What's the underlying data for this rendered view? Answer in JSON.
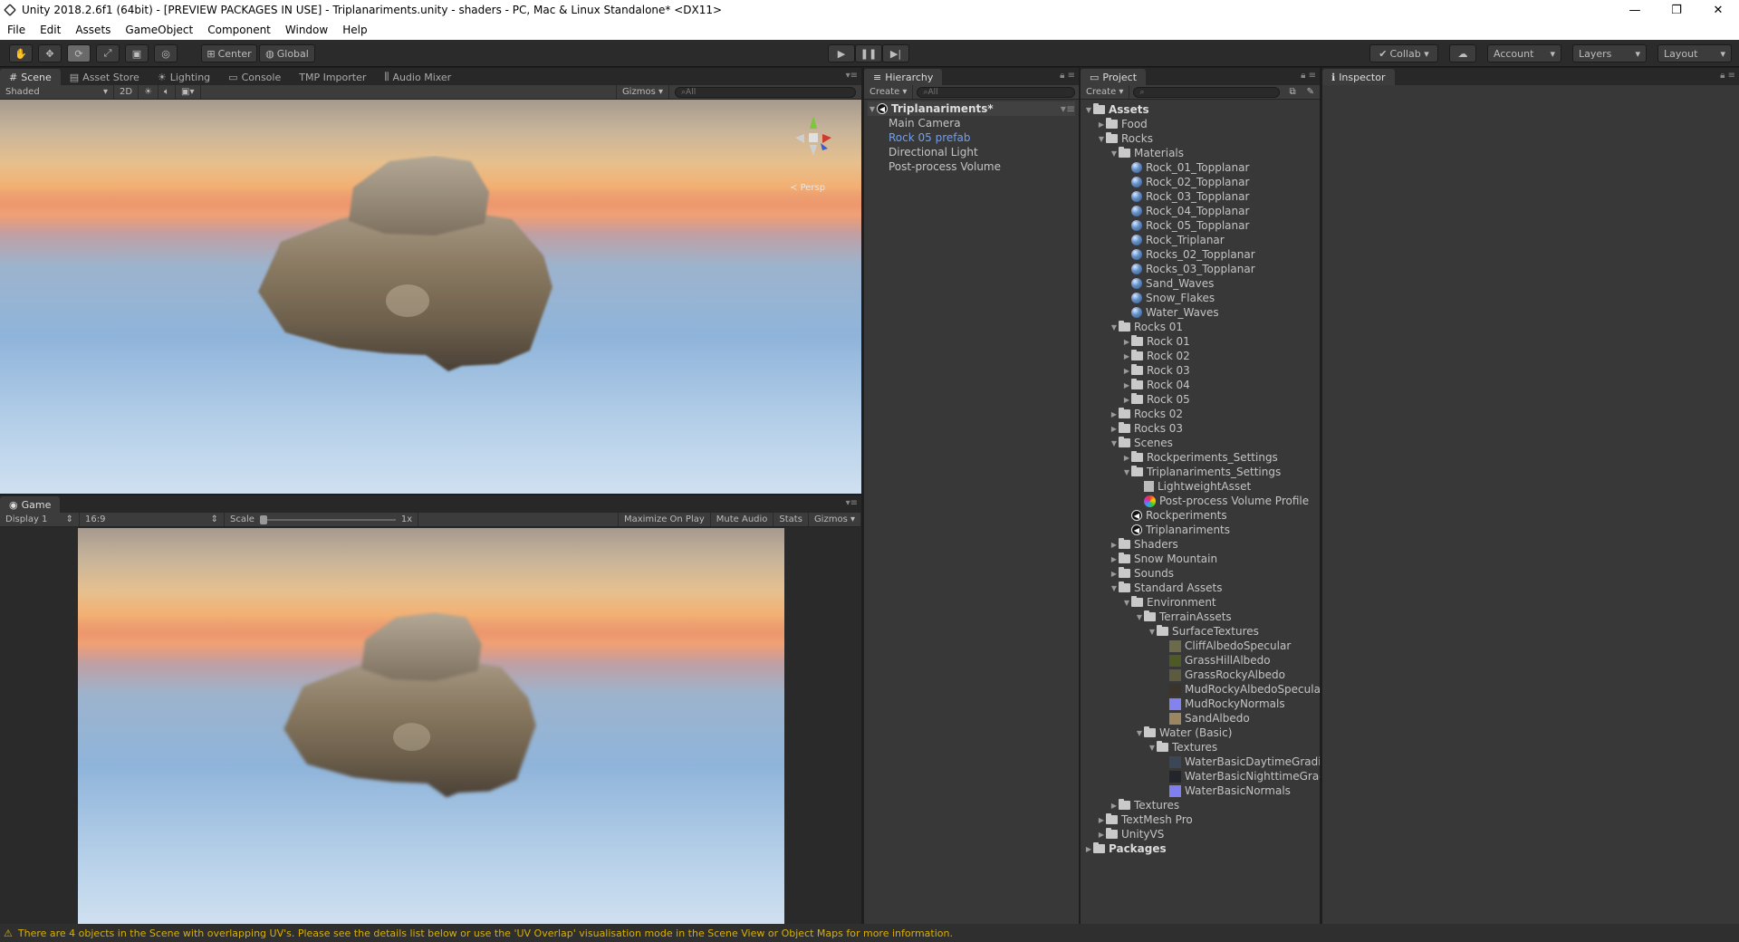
{
  "window": {
    "title": "Unity 2018.2.6f1 (64bit) - [PREVIEW PACKAGES IN USE] - Triplanariments.unity - shaders - PC, Mac & Linux Standalone* <DX11>",
    "minimize": "—",
    "maximize": "❐",
    "close": "✕"
  },
  "menu": [
    "File",
    "Edit",
    "Assets",
    "GameObject",
    "Component",
    "Window",
    "Help"
  ],
  "toolbar": {
    "tool_icons": [
      "hand-icon",
      "move-icon",
      "rotate-icon",
      "scale-icon",
      "rect-icon",
      "transform-icon"
    ],
    "pivot": "Center",
    "space": "Global",
    "collab": "Collab ▾",
    "account": "Account",
    "layers": "Layers",
    "layout": "Layout"
  },
  "scene_panel": {
    "tabs": [
      "Scene",
      "Asset Store",
      "Lighting",
      "Console",
      "TMP Importer",
      "Audio Mixer"
    ],
    "draw_mode": "Shaded",
    "mode_2d": "2D",
    "gizmos": "Gizmos",
    "search_placeholder": "All",
    "persp_label": "Persp"
  },
  "game_panel": {
    "tab": "Game",
    "display": "Display 1",
    "aspect": "16:9",
    "scale_label": "Scale",
    "scale_value": "1x",
    "maximize_on_play": "Maximize On Play",
    "mute_audio": "Mute Audio",
    "stats": "Stats",
    "gizmos": "Gizmos"
  },
  "hierarchy": {
    "tab": "Hierarchy",
    "create": "Create",
    "search_placeholder": "All",
    "scene_name": "Triplanariments*",
    "items": [
      {
        "label": "Main Camera",
        "color": "#c4c4c4"
      },
      {
        "label": "Rock 05 prefab",
        "color": "#6f9ff0"
      },
      {
        "label": "Directional Light",
        "color": "#c4c4c4"
      },
      {
        "label": "Post-process Volume",
        "color": "#c4c4c4"
      }
    ]
  },
  "project": {
    "tab": "Project",
    "create": "Create",
    "tree": [
      {
        "label": "Assets",
        "depth": 0,
        "arrow": "▼",
        "icon": "folder",
        "bold": true
      },
      {
        "label": "Food",
        "depth": 1,
        "arrow": "▶",
        "icon": "folder"
      },
      {
        "label": "Rocks",
        "depth": 1,
        "arrow": "▼",
        "icon": "folder"
      },
      {
        "label": "Materials",
        "depth": 2,
        "arrow": "▼",
        "icon": "folder"
      },
      {
        "label": "Rock_01_Topplanar",
        "depth": 3,
        "arrow": "",
        "icon": "sphere"
      },
      {
        "label": "Rock_02_Topplanar",
        "depth": 3,
        "arrow": "",
        "icon": "sphere"
      },
      {
        "label": "Rock_03_Topplanar",
        "depth": 3,
        "arrow": "",
        "icon": "sphere"
      },
      {
        "label": "Rock_04_Topplanar",
        "depth": 3,
        "arrow": "",
        "icon": "sphere"
      },
      {
        "label": "Rock_05_Topplanar",
        "depth": 3,
        "arrow": "",
        "icon": "sphere"
      },
      {
        "label": "Rock_Triplanar",
        "depth": 3,
        "arrow": "",
        "icon": "sphere"
      },
      {
        "label": "Rocks_02_Topplanar",
        "depth": 3,
        "arrow": "",
        "icon": "sphere"
      },
      {
        "label": "Rocks_03_Topplanar",
        "depth": 3,
        "arrow": "",
        "icon": "sphere"
      },
      {
        "label": "Sand_Waves",
        "depth": 3,
        "arrow": "",
        "icon": "sphere"
      },
      {
        "label": "Snow_Flakes",
        "depth": 3,
        "arrow": "",
        "icon": "sphere"
      },
      {
        "label": "Water_Waves",
        "depth": 3,
        "arrow": "",
        "icon": "sphere"
      },
      {
        "label": "Rocks 01",
        "depth": 2,
        "arrow": "▼",
        "icon": "folder"
      },
      {
        "label": "Rock 01",
        "depth": 3,
        "arrow": "▶",
        "icon": "folder"
      },
      {
        "label": "Rock 02",
        "depth": 3,
        "arrow": "▶",
        "icon": "folder"
      },
      {
        "label": "Rock 03",
        "depth": 3,
        "arrow": "▶",
        "icon": "folder"
      },
      {
        "label": "Rock 04",
        "depth": 3,
        "arrow": "▶",
        "icon": "folder"
      },
      {
        "label": "Rock 05",
        "depth": 3,
        "arrow": "▶",
        "icon": "folder"
      },
      {
        "label": "Rocks 02",
        "depth": 2,
        "arrow": "▶",
        "icon": "folder"
      },
      {
        "label": "Rocks 03",
        "depth": 2,
        "arrow": "▶",
        "icon": "folder"
      },
      {
        "label": "Scenes",
        "depth": 2,
        "arrow": "▼",
        "icon": "folder"
      },
      {
        "label": "Rockperiments_Settings",
        "depth": 3,
        "arrow": "▶",
        "icon": "folder"
      },
      {
        "label": "Triplanariments_Settings",
        "depth": 3,
        "arrow": "▼",
        "icon": "folder"
      },
      {
        "label": "LightweightAsset",
        "depth": 4,
        "arrow": "",
        "icon": "asset"
      },
      {
        "label": "Post-process Volume Profile",
        "depth": 4,
        "arrow": "",
        "icon": "profile"
      },
      {
        "label": "Rockperiments",
        "depth": 3,
        "arrow": "",
        "icon": "unity"
      },
      {
        "label": "Triplanariments",
        "depth": 3,
        "arrow": "",
        "icon": "unity"
      },
      {
        "label": "Shaders",
        "depth": 2,
        "arrow": "▶",
        "icon": "folder"
      },
      {
        "label": "Snow Mountain",
        "depth": 2,
        "arrow": "▶",
        "icon": "folder"
      },
      {
        "label": "Sounds",
        "depth": 2,
        "arrow": "▶",
        "icon": "folder"
      },
      {
        "label": "Standard Assets",
        "depth": 2,
        "arrow": "▼",
        "icon": "folder"
      },
      {
        "label": "Environment",
        "depth": 3,
        "arrow": "▼",
        "icon": "folder"
      },
      {
        "label": "TerrainAssets",
        "depth": 4,
        "arrow": "▼",
        "icon": "folder"
      },
      {
        "label": "SurfaceTextures",
        "depth": 5,
        "arrow": "▼",
        "icon": "folder"
      },
      {
        "label": "CliffAlbedoSpecular",
        "depth": 6,
        "arrow": "",
        "icon": "swatch",
        "color": "#6b6a4a"
      },
      {
        "label": "GrassHillAlbedo",
        "depth": 6,
        "arrow": "",
        "icon": "swatch",
        "color": "#4d5a25"
      },
      {
        "label": "GrassRockyAlbedo",
        "depth": 6,
        "arrow": "",
        "icon": "swatch",
        "color": "#5c5a3f"
      },
      {
        "label": "MudRockyAlbedoSpecular",
        "depth": 6,
        "arrow": "",
        "icon": "swatch",
        "color": "#3a342c"
      },
      {
        "label": "MudRockyNormals",
        "depth": 6,
        "arrow": "",
        "icon": "swatch",
        "color": "#8483ee"
      },
      {
        "label": "SandAlbedo",
        "depth": 6,
        "arrow": "",
        "icon": "swatch",
        "color": "#9a8660"
      },
      {
        "label": "Water (Basic)",
        "depth": 4,
        "arrow": "▼",
        "icon": "folder"
      },
      {
        "label": "Textures",
        "depth": 5,
        "arrow": "▼",
        "icon": "folder"
      },
      {
        "label": "WaterBasicDaytimeGradie",
        "depth": 6,
        "arrow": "",
        "icon": "swatch",
        "color": "#3b4757"
      },
      {
        "label": "WaterBasicNighttimeGrad",
        "depth": 6,
        "arrow": "",
        "icon": "swatch",
        "color": "#22262c"
      },
      {
        "label": "WaterBasicNormals",
        "depth": 6,
        "arrow": "",
        "icon": "swatch",
        "color": "#7f7ff0"
      },
      {
        "label": "Textures",
        "depth": 2,
        "arrow": "▶",
        "icon": "folder"
      },
      {
        "label": "TextMesh Pro",
        "depth": 1,
        "arrow": "▶",
        "icon": "folder"
      },
      {
        "label": "UnityVS",
        "depth": 1,
        "arrow": "▶",
        "icon": "folder"
      },
      {
        "label": "Packages",
        "depth": 0,
        "arrow": "▶",
        "icon": "folder",
        "bold": true
      }
    ]
  },
  "inspector": {
    "tab": "Inspector"
  },
  "status": {
    "icon": "warning-icon",
    "message": "There are 4 objects in the Scene with overlapping UV's. Please see the details list below or use the 'UV Overlap' visualisation mode in the Scene View or Object Maps for more information."
  }
}
